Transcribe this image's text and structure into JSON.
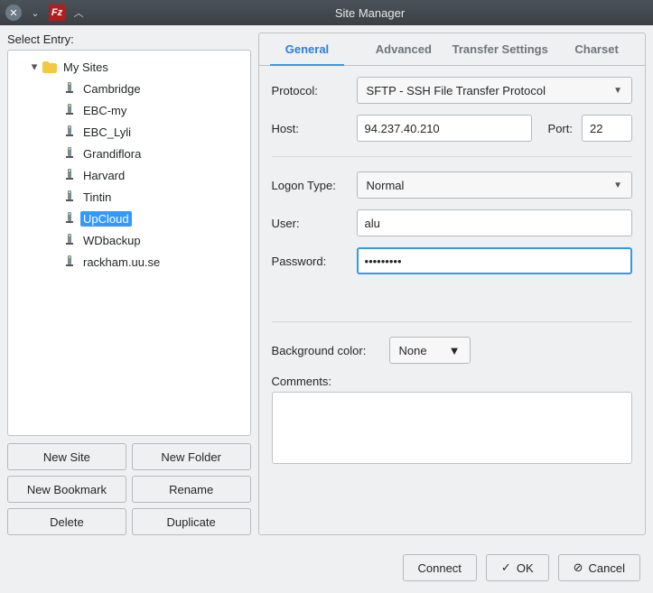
{
  "window": {
    "title": "Site Manager"
  },
  "tree": {
    "select_label": "Select Entry:",
    "root": "My Sites",
    "sites": [
      "Cambridge",
      "EBC-my",
      "EBC_Lyli",
      "Grandiflora",
      "Harvard",
      "Tintin",
      "UpCloud",
      "WDbackup",
      "rackham.uu.se"
    ],
    "selected": "UpCloud"
  },
  "buttons": {
    "new_site": "New Site",
    "new_folder": "New Folder",
    "new_bookmark": "New Bookmark",
    "rename": "Rename",
    "delete": "Delete",
    "duplicate": "Duplicate"
  },
  "tabs": {
    "general": "General",
    "advanced": "Advanced",
    "transfer": "Transfer Settings",
    "charset": "Charset",
    "active": "general"
  },
  "form": {
    "protocol_label": "Protocol:",
    "protocol_value": "SFTP - SSH File Transfer Protocol",
    "host_label": "Host:",
    "host_value": "94.237.40.210",
    "port_label": "Port:",
    "port_value": "22",
    "logon_label": "Logon Type:",
    "logon_value": "Normal",
    "user_label": "User:",
    "user_value": "alu",
    "password_label": "Password:",
    "password_value": "•••••••••",
    "bgcolor_label": "Background color:",
    "bgcolor_value": "None",
    "comments_label": "Comments:",
    "comments_value": ""
  },
  "footer": {
    "connect": "Connect",
    "ok": "OK",
    "cancel": "Cancel"
  }
}
